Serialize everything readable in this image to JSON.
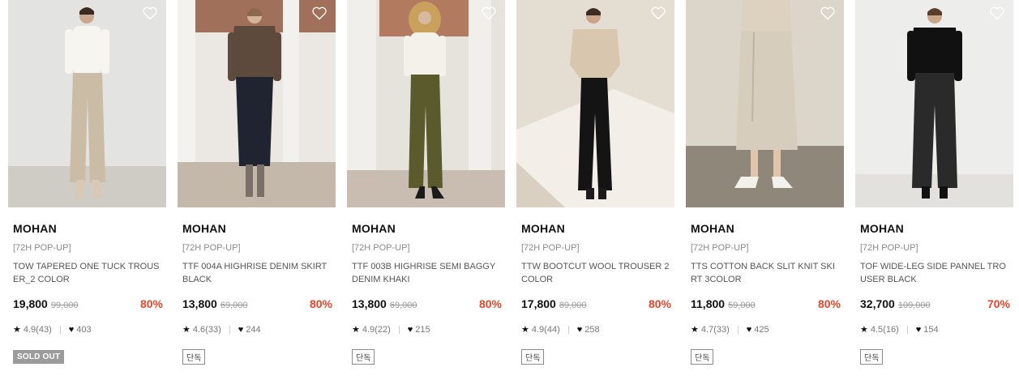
{
  "products": [
    {
      "brand": "MOHAN",
      "tag": "[72H POP-UP]",
      "title": "TOW TAPERED ONE TUCK TROUSER_2 COLOR",
      "price": "19,800",
      "original_price": "99,000",
      "discount": "80%",
      "rating": "4.9(43)",
      "likes": "403",
      "badge": "SOLD OUT",
      "badge_type": "soldout"
    },
    {
      "brand": "MOHAN",
      "tag": "[72H POP-UP]",
      "title": "TTF 004A HIGHRISE DENIM SKIRT BLACK",
      "price": "13,800",
      "original_price": "69,000",
      "discount": "80%",
      "rating": "4.6(33)",
      "likes": "244",
      "badge": "단독",
      "badge_type": "exclusive"
    },
    {
      "brand": "MOHAN",
      "tag": "[72H POP-UP]",
      "title": "TTF 003B HIGHRISE SEMI BAGGY DENIM KHAKI",
      "price": "13,800",
      "original_price": "69,000",
      "discount": "80%",
      "rating": "4.9(22)",
      "likes": "215",
      "badge": "단독",
      "badge_type": "exclusive"
    },
    {
      "brand": "MOHAN",
      "tag": "[72H POP-UP]",
      "title": "TTW BOOTCUT WOOL TROUSER 2COLOR",
      "price": "17,800",
      "original_price": "89,000",
      "discount": "80%",
      "rating": "4.9(44)",
      "likes": "258",
      "badge": "단독",
      "badge_type": "exclusive"
    },
    {
      "brand": "MOHAN",
      "tag": "[72H POP-UP]",
      "title": "TTS COTTON BACK SLIT KNIT SKIRT 3COLOR",
      "price": "11,800",
      "original_price": "59,000",
      "discount": "80%",
      "rating": "4.7(33)",
      "likes": "425",
      "badge": "단독",
      "badge_type": "exclusive"
    },
    {
      "brand": "MOHAN",
      "tag": "[72H POP-UP]",
      "title": "TOF WIDE-LEG SIDE PANNEL TROUSER BLACK",
      "price": "32,700",
      "original_price": "109,000",
      "discount": "70%",
      "rating": "4.5(16)",
      "likes": "154",
      "badge": "단독",
      "badge_type": "exclusive"
    }
  ],
  "icons": {
    "wishlist": "heart-outline-icon",
    "rating": "star-icon",
    "likes": "heart-filled-icon"
  },
  "colors": {
    "discount": "#e8452b",
    "soldout_badge": "#9b9b9b"
  }
}
